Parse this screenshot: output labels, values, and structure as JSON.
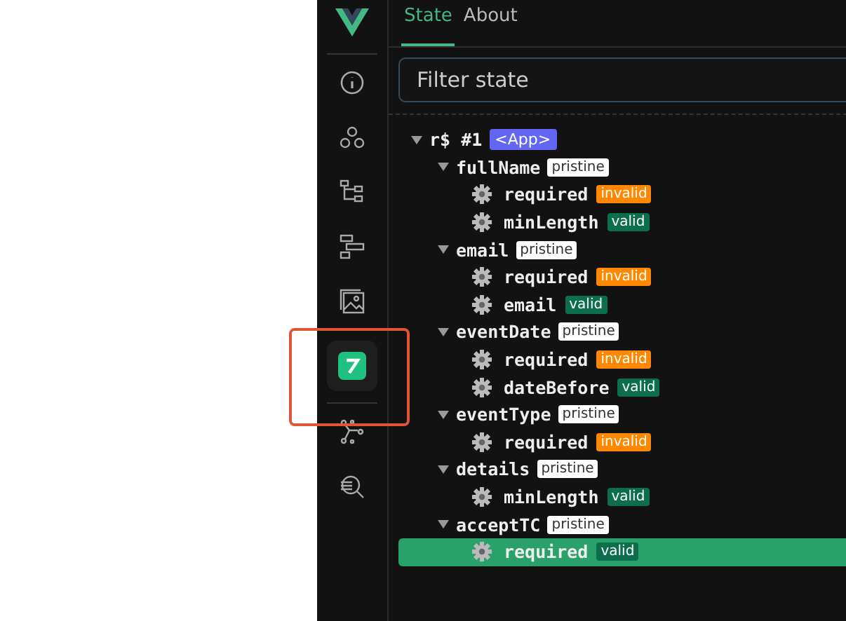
{
  "tabs": [
    {
      "label": "State",
      "selected": true
    },
    {
      "label": "About",
      "selected": false
    }
  ],
  "sidebar": {
    "items": [
      {
        "kind": "info",
        "selected": false
      },
      {
        "kind": "components",
        "selected": false
      },
      {
        "kind": "tree",
        "selected": false
      },
      {
        "kind": "timeline",
        "selected": false
      },
      {
        "kind": "image",
        "selected": false
      },
      {
        "kind": "app",
        "selected": true
      },
      {
        "kind": "graph",
        "selected": false
      },
      {
        "kind": "inspect",
        "selected": false
      }
    ]
  },
  "search": {
    "placeholder": "Filter state"
  },
  "tree": {
    "label": "r$ #1",
    "tag": "<App>",
    "expanded": true,
    "children": [
      {
        "label": "fullName",
        "badge": "pristine",
        "expanded": true,
        "children": [
          {
            "label": "required",
            "status": "invalid",
            "valid": false,
            "selected": false
          },
          {
            "label": "minLength",
            "status": "valid",
            "valid": true,
            "selected": false
          }
        ]
      },
      {
        "label": "email",
        "badge": "pristine",
        "expanded": true,
        "children": [
          {
            "label": "required",
            "status": "invalid",
            "valid": false,
            "selected": false
          },
          {
            "label": "email",
            "status": "valid",
            "valid": true,
            "selected": false
          }
        ]
      },
      {
        "label": "eventDate",
        "badge": "pristine",
        "expanded": true,
        "children": [
          {
            "label": "required",
            "status": "invalid",
            "valid": false,
            "selected": false
          },
          {
            "label": "dateBefore",
            "status": "valid",
            "valid": true,
            "selected": false
          }
        ]
      },
      {
        "label": "eventType",
        "badge": "pristine",
        "expanded": true,
        "children": [
          {
            "label": "required",
            "status": "invalid",
            "valid": false,
            "selected": false
          }
        ]
      },
      {
        "label": "details",
        "badge": "pristine",
        "expanded": true,
        "children": [
          {
            "label": "minLength",
            "status": "valid",
            "valid": true,
            "selected": false
          }
        ]
      },
      {
        "label": "acceptTC",
        "badge": "pristine",
        "expanded": true,
        "children": [
          {
            "label": "required",
            "status": "valid",
            "valid": true,
            "selected": true
          }
        ]
      }
    ]
  }
}
